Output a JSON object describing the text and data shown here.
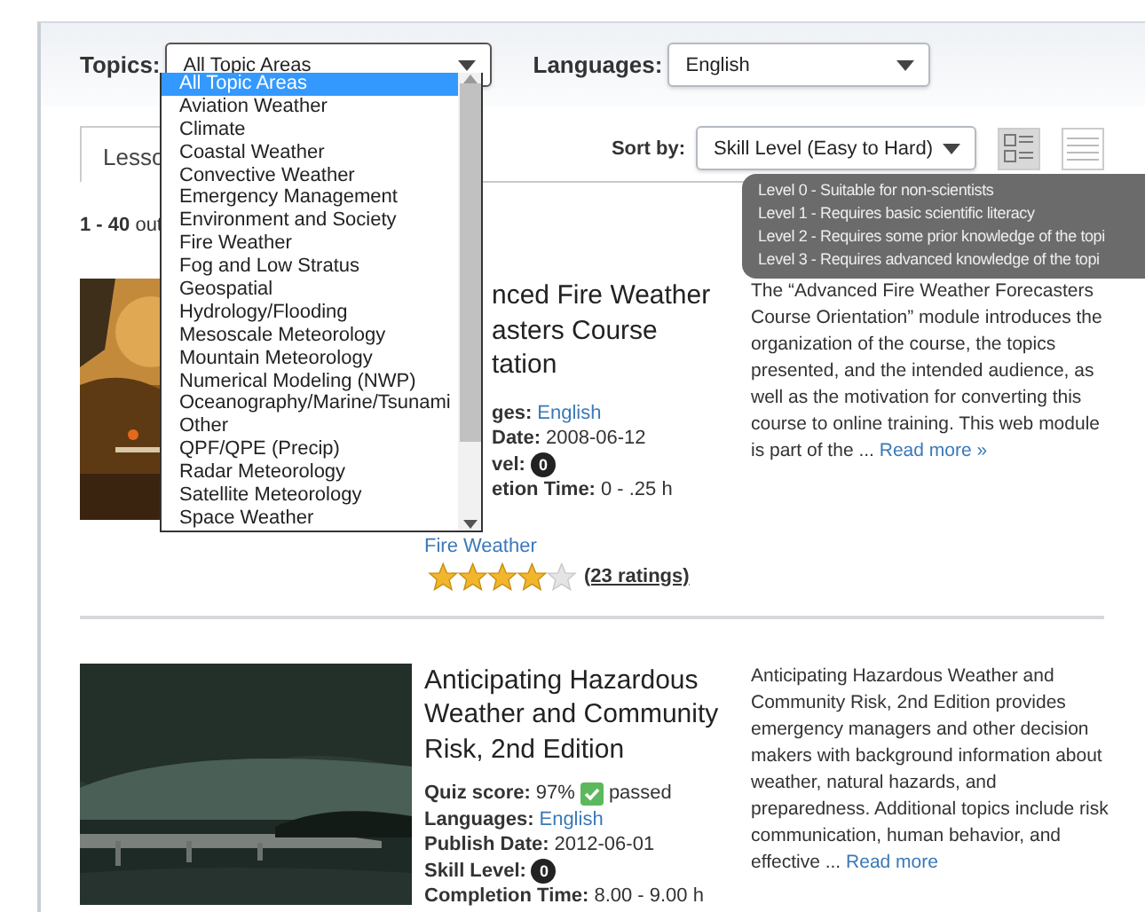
{
  "filters": {
    "topics": {
      "label": "Topics:",
      "value": "All Topic Areas",
      "expanded": true,
      "options": [
        {
          "label": "All Topic Areas",
          "selected": true
        },
        {
          "label": "Aviation Weather",
          "selected": false
        },
        {
          "label": "Climate",
          "selected": false
        },
        {
          "label": "Coastal Weather",
          "selected": false
        },
        {
          "label": "Convective Weather",
          "selected": false
        },
        {
          "label": "Emergency Management",
          "selected": false
        },
        {
          "label": "Environment and Society",
          "selected": false
        },
        {
          "label": "Fire Weather",
          "selected": false
        },
        {
          "label": "Fog and Low Stratus",
          "selected": false
        },
        {
          "label": "Geospatial",
          "selected": false
        },
        {
          "label": "Hydrology/Flooding",
          "selected": false
        },
        {
          "label": "Mesoscale Meteorology",
          "selected": false
        },
        {
          "label": "Mountain Meteorology",
          "selected": false
        },
        {
          "label": "Numerical Modeling (NWP)",
          "selected": false
        },
        {
          "label": "Oceanography/Marine/Tsunami",
          "selected": false
        },
        {
          "label": "Other",
          "selected": false
        },
        {
          "label": "QPF/QPE (Precip)",
          "selected": false
        },
        {
          "label": "Radar Meteorology",
          "selected": false
        },
        {
          "label": "Satellite Meteorology",
          "selected": false
        },
        {
          "label": "Space Weather",
          "selected": false
        }
      ]
    },
    "languages": {
      "label": "Languages:",
      "value": "English"
    }
  },
  "tabs": [
    {
      "label": "Lesso",
      "selected": true
    }
  ],
  "results_count": "**1 - 40** out",
  "sort": {
    "label": "Sort by:",
    "value": "Skill Level (Easy to Hard)"
  },
  "view_buttons": [
    {
      "kind": "detail",
      "selected": true
    },
    {
      "kind": "list",
      "selected": false
    }
  ],
  "tooltip": {
    "lines": [
      "Level 0 - Suitable for non-scientists",
      "Level 1 - Requires basic scientific literacy",
      "Level 2 - Requires some prior knowledge of the topi",
      "Level 3 - Requires advanced knowledge of the topi"
    ]
  },
  "courses": [
    {
      "kind": "partial",
      "title_lines": [
        "nced Fire Weather",
        "asters Course",
        "tation"
      ],
      "fields": [
        {
          "kind": "link",
          "label": "ges:",
          "value": "English"
        },
        {
          "kind": "text",
          "label": "Date:",
          "value": "2008-06-12"
        },
        {
          "kind": "badge",
          "label": "vel:",
          "value": "0"
        },
        {
          "kind": "text",
          "label": "etion Time:",
          "value": "0 - .25 h"
        }
      ],
      "topic": "Fire Weather",
      "stars": 4,
      "ratings": "(23 ratings)",
      "description": "The “Advanced Fire Weather Forecasters Course Orientation” module introduces the organization of the course, the topics presented, and the intended audience, as well as the motivation for converting this course to online training. This web module is part of the ...",
      "read_more": "Read more »"
    },
    {
      "kind": "full",
      "title": "Anticipating Hazardous Weather and Community Risk, 2nd Edition",
      "fields": [
        {
          "kind": "quiz",
          "label": "Quiz score:",
          "value": "97%",
          "status": "passed"
        },
        {
          "kind": "link",
          "label": "Languages:",
          "value": "English"
        },
        {
          "kind": "text",
          "label": "Publish Date:",
          "value": "2012-06-01"
        },
        {
          "kind": "badge",
          "label": "Skill Level:",
          "value": "0"
        },
        {
          "kind": "text",
          "label": "Completion Time:",
          "value": "8.00 - 9.00 h"
        }
      ],
      "description": "Anticipating Hazardous Weather and Community Risk, 2nd Edition provides emergency managers and other decision makers with background information about weather, natural hazards, and preparedness. Additional topics include risk communication, human behavior, and effective ...",
      "read_more": "Read more"
    }
  ]
}
